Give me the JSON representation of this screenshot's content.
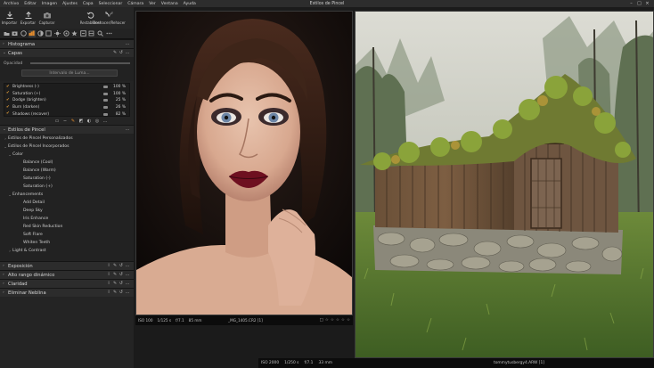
{
  "window": {
    "title": "Estilos de Pincel"
  },
  "menu": [
    "Archivo",
    "Editar",
    "Imagen",
    "Ajustes",
    "Capa",
    "Seleccionar",
    "Cámara",
    "Ver",
    "Ventana",
    "Ayuda"
  ],
  "toolbar": {
    "importar": "Importar",
    "exportar": "Exportar",
    "capturar": "Capturar",
    "restablecer": "Restablecer",
    "deshacer": "Deshacer/Rehacer"
  },
  "panel": {
    "histograma": "Histograma",
    "capas": "Capas",
    "opacidad": "Opacidad",
    "intervalo_luma": "Intervalo de Luma...",
    "layers": [
      {
        "name": "Brightness (-)",
        "opacity": "100 %"
      },
      {
        "name": "Saturation (+)",
        "opacity": "100 %"
      },
      {
        "name": "Dodge (brighten)",
        "opacity": "25 %"
      },
      {
        "name": "Burn (darken)",
        "opacity": "26 %"
      },
      {
        "name": "Shadows (recover)",
        "opacity": "82 %"
      }
    ],
    "estilos_pincel": "Estilos de Pincel",
    "tree": {
      "personalizados": "Estilos de Pincel Personalizados",
      "incorporados": "Estilos de Pincel Incorporados",
      "color": "Color",
      "color_items": [
        "Balance (Cool)",
        "Balance (Warm)",
        "Saturation (-)",
        "Saturation (+)"
      ],
      "enhancements": "Enhancements",
      "enhancement_items": [
        "Add Detail",
        "Deep Sky",
        "Iris Enhance",
        "Red Skin Reduction",
        "Soft Flare",
        "Whiten Teeth"
      ],
      "light_contrast": "Light & Contrast"
    },
    "exposicion": "Exposición",
    "alto_rango": "Alto rango dinámico",
    "claridad": "Claridad",
    "eliminar_neblina": "Eliminar Neblina"
  },
  "viewer": {
    "image1": {
      "iso": "ISO 100",
      "shutter": "1/125 s",
      "aperture": "f/7.1",
      "focal": "85 mm",
      "filename": "_MG_1405.CR2 [1]"
    },
    "image2": {
      "iso": "ISO 2000",
      "shutter": "1/250 s",
      "aperture": "f/7.1",
      "focal": "33 mm",
      "filename": "tommytusbergy4.ARW [1]"
    }
  }
}
